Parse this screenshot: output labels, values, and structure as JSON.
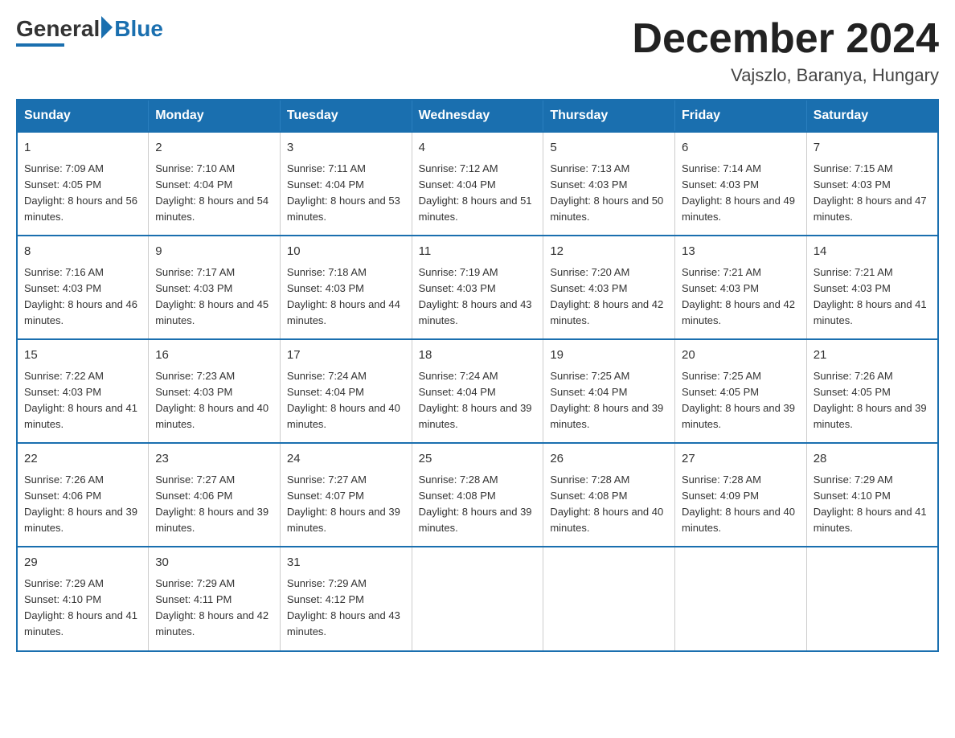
{
  "logo": {
    "general": "General",
    "blue": "Blue"
  },
  "title": {
    "month_year": "December 2024",
    "location": "Vajszlo, Baranya, Hungary"
  },
  "header": {
    "days": [
      "Sunday",
      "Monday",
      "Tuesday",
      "Wednesday",
      "Thursday",
      "Friday",
      "Saturday"
    ]
  },
  "weeks": [
    [
      {
        "day": "1",
        "sunrise": "7:09 AM",
        "sunset": "4:05 PM",
        "daylight": "8 hours and 56 minutes."
      },
      {
        "day": "2",
        "sunrise": "7:10 AM",
        "sunset": "4:04 PM",
        "daylight": "8 hours and 54 minutes."
      },
      {
        "day": "3",
        "sunrise": "7:11 AM",
        "sunset": "4:04 PM",
        "daylight": "8 hours and 53 minutes."
      },
      {
        "day": "4",
        "sunrise": "7:12 AM",
        "sunset": "4:04 PM",
        "daylight": "8 hours and 51 minutes."
      },
      {
        "day": "5",
        "sunrise": "7:13 AM",
        "sunset": "4:03 PM",
        "daylight": "8 hours and 50 minutes."
      },
      {
        "day": "6",
        "sunrise": "7:14 AM",
        "sunset": "4:03 PM",
        "daylight": "8 hours and 49 minutes."
      },
      {
        "day": "7",
        "sunrise": "7:15 AM",
        "sunset": "4:03 PM",
        "daylight": "8 hours and 47 minutes."
      }
    ],
    [
      {
        "day": "8",
        "sunrise": "7:16 AM",
        "sunset": "4:03 PM",
        "daylight": "8 hours and 46 minutes."
      },
      {
        "day": "9",
        "sunrise": "7:17 AM",
        "sunset": "4:03 PM",
        "daylight": "8 hours and 45 minutes."
      },
      {
        "day": "10",
        "sunrise": "7:18 AM",
        "sunset": "4:03 PM",
        "daylight": "8 hours and 44 minutes."
      },
      {
        "day": "11",
        "sunrise": "7:19 AM",
        "sunset": "4:03 PM",
        "daylight": "8 hours and 43 minutes."
      },
      {
        "day": "12",
        "sunrise": "7:20 AM",
        "sunset": "4:03 PM",
        "daylight": "8 hours and 42 minutes."
      },
      {
        "day": "13",
        "sunrise": "7:21 AM",
        "sunset": "4:03 PM",
        "daylight": "8 hours and 42 minutes."
      },
      {
        "day": "14",
        "sunrise": "7:21 AM",
        "sunset": "4:03 PM",
        "daylight": "8 hours and 41 minutes."
      }
    ],
    [
      {
        "day": "15",
        "sunrise": "7:22 AM",
        "sunset": "4:03 PM",
        "daylight": "8 hours and 41 minutes."
      },
      {
        "day": "16",
        "sunrise": "7:23 AM",
        "sunset": "4:03 PM",
        "daylight": "8 hours and 40 minutes."
      },
      {
        "day": "17",
        "sunrise": "7:24 AM",
        "sunset": "4:04 PM",
        "daylight": "8 hours and 40 minutes."
      },
      {
        "day": "18",
        "sunrise": "7:24 AM",
        "sunset": "4:04 PM",
        "daylight": "8 hours and 39 minutes."
      },
      {
        "day": "19",
        "sunrise": "7:25 AM",
        "sunset": "4:04 PM",
        "daylight": "8 hours and 39 minutes."
      },
      {
        "day": "20",
        "sunrise": "7:25 AM",
        "sunset": "4:05 PM",
        "daylight": "8 hours and 39 minutes."
      },
      {
        "day": "21",
        "sunrise": "7:26 AM",
        "sunset": "4:05 PM",
        "daylight": "8 hours and 39 minutes."
      }
    ],
    [
      {
        "day": "22",
        "sunrise": "7:26 AM",
        "sunset": "4:06 PM",
        "daylight": "8 hours and 39 minutes."
      },
      {
        "day": "23",
        "sunrise": "7:27 AM",
        "sunset": "4:06 PM",
        "daylight": "8 hours and 39 minutes."
      },
      {
        "day": "24",
        "sunrise": "7:27 AM",
        "sunset": "4:07 PM",
        "daylight": "8 hours and 39 minutes."
      },
      {
        "day": "25",
        "sunrise": "7:28 AM",
        "sunset": "4:08 PM",
        "daylight": "8 hours and 39 minutes."
      },
      {
        "day": "26",
        "sunrise": "7:28 AM",
        "sunset": "4:08 PM",
        "daylight": "8 hours and 40 minutes."
      },
      {
        "day": "27",
        "sunrise": "7:28 AM",
        "sunset": "4:09 PM",
        "daylight": "8 hours and 40 minutes."
      },
      {
        "day": "28",
        "sunrise": "7:29 AM",
        "sunset": "4:10 PM",
        "daylight": "8 hours and 41 minutes."
      }
    ],
    [
      {
        "day": "29",
        "sunrise": "7:29 AM",
        "sunset": "4:10 PM",
        "daylight": "8 hours and 41 minutes."
      },
      {
        "day": "30",
        "sunrise": "7:29 AM",
        "sunset": "4:11 PM",
        "daylight": "8 hours and 42 minutes."
      },
      {
        "day": "31",
        "sunrise": "7:29 AM",
        "sunset": "4:12 PM",
        "daylight": "8 hours and 43 minutes."
      },
      null,
      null,
      null,
      null
    ]
  ]
}
